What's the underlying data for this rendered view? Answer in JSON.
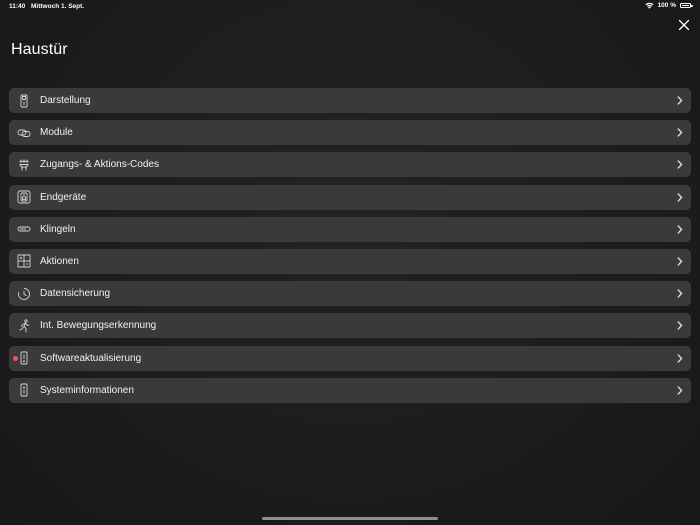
{
  "status_bar": {
    "time": "11:40",
    "date": "Mittwoch 1. Sept.",
    "battery_percent": "100 %",
    "wifi_icon": "wifi-icon",
    "battery_icon": "battery-full-icon"
  },
  "header": {
    "title": "Haustür",
    "close_icon": "close-icon"
  },
  "menu": {
    "items": [
      {
        "label": "Darstellung",
        "icon": "doorbell-panel-icon"
      },
      {
        "label": "Module",
        "icon": "modules-icon"
      },
      {
        "label": "Zugangs- & Aktions-Codes",
        "icon": "keypad-icon"
      },
      {
        "label": "Endgeräte",
        "icon": "devices-icon"
      },
      {
        "label": "Klingeln",
        "icon": "bell-button-icon"
      },
      {
        "label": "Aktionen",
        "icon": "actions-icon"
      },
      {
        "label": "Datensicherung",
        "icon": "backup-clock-icon"
      },
      {
        "label": "Int. Bewegungserkennung",
        "icon": "motion-person-icon"
      },
      {
        "label": "Softwareaktualisierung",
        "icon": "device-update-icon",
        "has_notification": true
      },
      {
        "label": "Systeminformationen",
        "icon": "device-info-icon"
      }
    ]
  },
  "colors": {
    "background": "#1e1e1e",
    "row_background": "#3a3a3c",
    "text": "#ffffff",
    "icon": "#d8d8d8",
    "notification_dot": "#ff4d55",
    "home_indicator": "#8e8e8e"
  }
}
